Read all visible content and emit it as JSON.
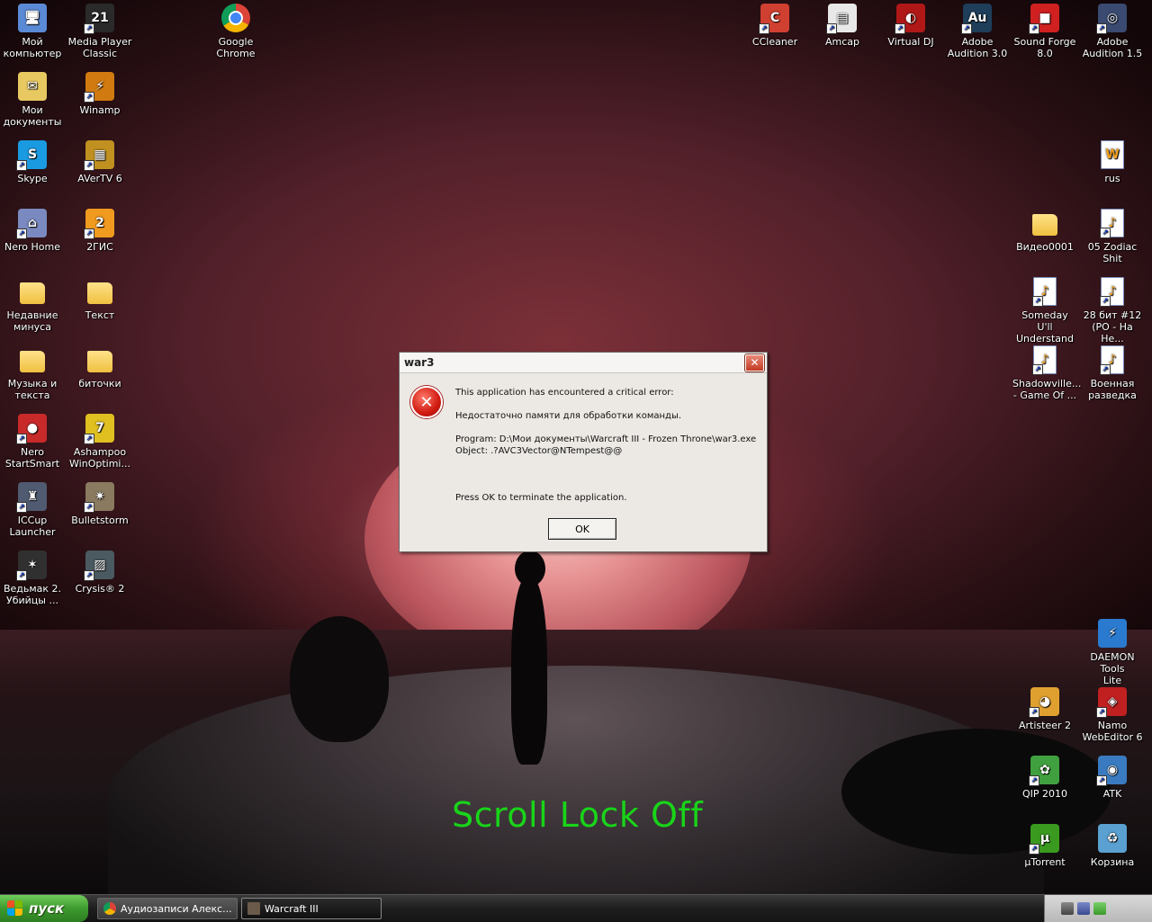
{
  "desktop": {
    "left_icons": [
      {
        "label": "Мой\nкомпьютер",
        "glyph": "🖥",
        "color": "#5a8ad6",
        "shortcut": false
      },
      {
        "label": "Media Player\nClassic",
        "glyph": "21",
        "color": "#2a2a2a",
        "shortcut": true
      },
      {
        "label": "Мои\nдокументы",
        "glyph": "✉",
        "color": "#e8c860",
        "shortcut": false
      },
      {
        "label": "Winamp",
        "glyph": "⚡",
        "color": "#d07a10",
        "shortcut": true
      },
      {
        "label": "Skype",
        "glyph": "S",
        "color": "#1a9ae0",
        "shortcut": true
      },
      {
        "label": "AVerTV 6",
        "glyph": "▦",
        "color": "#c09020",
        "shortcut": true
      },
      {
        "label": "Nero Home",
        "glyph": "⌂",
        "color": "#7a8ac0",
        "shortcut": true
      },
      {
        "label": "2ГИС",
        "glyph": "2",
        "color": "#f09a20",
        "shortcut": true
      },
      {
        "label": "Недавние\nминуса",
        "glyph": "",
        "color": "folder",
        "shortcut": false
      },
      {
        "label": "Текст",
        "glyph": "",
        "color": "folder",
        "shortcut": false
      },
      {
        "label": "Музыка и\nтекста",
        "glyph": "",
        "color": "folder",
        "shortcut": false
      },
      {
        "label": "биточки",
        "glyph": "",
        "color": "folder",
        "shortcut": false
      },
      {
        "label": "Nero\nStartSmart",
        "glyph": "●",
        "color": "#c82a2a",
        "shortcut": true
      },
      {
        "label": "Ashampoo\nWinOptimi...",
        "glyph": "7",
        "color": "#e0c020",
        "shortcut": true
      },
      {
        "label": "ICCup\nLauncher",
        "glyph": "♜",
        "color": "#505a70",
        "shortcut": true
      },
      {
        "label": "Bulletstorm",
        "glyph": "✷",
        "color": "#8a7a60",
        "shortcut": true
      },
      {
        "label": "Ведьмак 2.\nУбийцы ...",
        "glyph": "✶",
        "color": "#303030",
        "shortcut": true
      },
      {
        "label": "Crysis® 2",
        "glyph": "▨",
        "color": "#4a5a60",
        "shortcut": true
      }
    ],
    "chrome_icon": {
      "label": "Google\nChrome",
      "color": "#e0452f"
    },
    "top_right_icons": [
      {
        "label": "CCleaner",
        "glyph": "C",
        "color": "#d04030",
        "shortcut": true
      },
      {
        "label": "Amcap",
        "glyph": "▤",
        "color": "#e8e8e8",
        "shortcut": true
      },
      {
        "label": "Virtual DJ",
        "glyph": "◐",
        "color": "#b01818",
        "shortcut": true
      },
      {
        "label": "Adobe\nAudition 3.0",
        "glyph": "Au",
        "color": "#1e3e5a",
        "shortcut": true
      },
      {
        "label": "Sound Forge\n8.0",
        "glyph": "■",
        "color": "#d02020",
        "shortcut": true
      },
      {
        "label": "Adobe\nAudition 1.5",
        "glyph": "◎",
        "color": "#3a4a70",
        "shortcut": true
      }
    ],
    "right_icons": [
      {
        "label": "rus",
        "glyph": "W",
        "type": "doc",
        "shortcut": false
      },
      {
        "label": "Видео0001",
        "glyph": "",
        "type": "folder",
        "shortcut": false
      },
      {
        "label": "05 Zodiac Shit",
        "glyph": "♪",
        "type": "doc",
        "shortcut": true
      },
      {
        "label": "Someday U'll\nUnderstand",
        "glyph": "♪",
        "type": "doc",
        "shortcut": true
      },
      {
        "label": "28 бит #12\n(PO - На Не...",
        "glyph": "♪",
        "type": "doc",
        "shortcut": true
      },
      {
        "label": "Shadowville...\n- Game Of ...",
        "glyph": "♪",
        "type": "doc",
        "shortcut": true
      },
      {
        "label": "Военная\nразведка",
        "glyph": "♪",
        "type": "doc",
        "shortcut": true
      },
      {
        "label": "DAEMON Tools\nLite",
        "glyph": "⚡",
        "type": "app",
        "color": "#2a7ad0",
        "shortcut": false
      },
      {
        "label": "Artisteer 2",
        "glyph": "◕",
        "type": "app",
        "color": "#e0a030",
        "shortcut": true
      },
      {
        "label": "Namo\nWebEditor 6",
        "glyph": "◈",
        "type": "app",
        "color": "#c02020",
        "shortcut": true
      },
      {
        "label": "QIP 2010",
        "glyph": "✿",
        "type": "app",
        "color": "#40a040",
        "shortcut": true
      },
      {
        "label": "ATK",
        "glyph": "◉",
        "type": "app",
        "color": "#3a7ac0",
        "shortcut": true
      },
      {
        "label": "µTorrent",
        "glyph": "µ",
        "type": "app",
        "color": "#3a9a20",
        "shortcut": true
      },
      {
        "label": "Корзина",
        "glyph": "♻",
        "type": "app",
        "color": "#5aa0d0",
        "shortcut": false
      }
    ]
  },
  "dialog": {
    "title": "war3",
    "close_glyph": "✕",
    "error_glyph": "✕",
    "line1": "This application has encountered a critical error:",
    "line2": "Недостаточно памяти для обработки команды.",
    "line3": "Program:  D:\\Мои документы\\Warcraft III - Frozen Throne\\war3.exe",
    "line4": "Object:     .?AVC3Vector@NTempest@@",
    "line5": "Press OK to terminate the application.",
    "ok_label": "OK"
  },
  "overlay": {
    "scroll_lock": "Scroll Lock Off",
    "color": "#19d419"
  },
  "taskbar": {
    "start_label": "пуск",
    "tasks": [
      {
        "label": "Аудиозаписи Алекс...",
        "active": false
      },
      {
        "label": "Warcraft III",
        "active": true
      }
    ]
  }
}
